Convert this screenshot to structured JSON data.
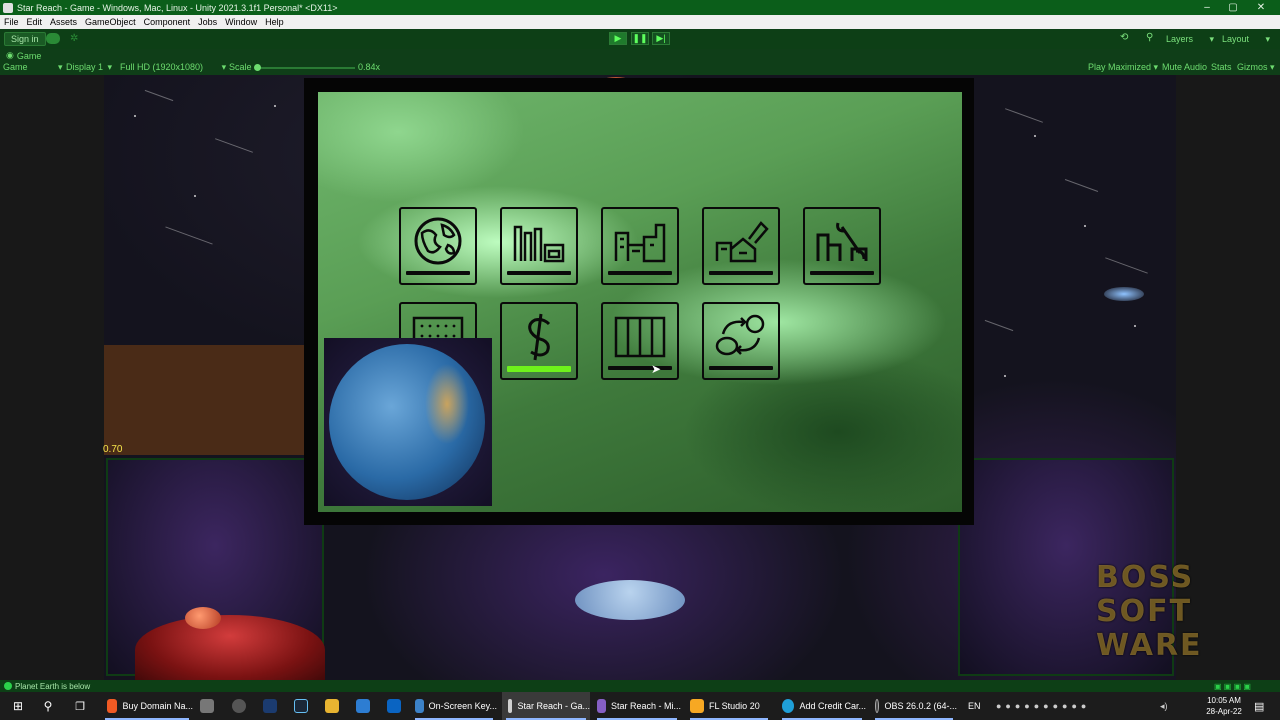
{
  "window": {
    "title": "Star Reach - Game - Windows, Mac, Linux - Unity 2021.3.1f1 Personal* <DX11>",
    "controls": [
      "–",
      "▢",
      "✕"
    ]
  },
  "menu": [
    "File",
    "Edit",
    "Assets",
    "GameObject",
    "Component",
    "Jobs",
    "Window",
    "Help"
  ],
  "toolbar": {
    "sign_in": "Sign in",
    "layers": "Layers",
    "layout": "Layout"
  },
  "game_view": {
    "tab": "Game",
    "mode": "Game",
    "display": "Display 1",
    "resolution": "Full HD (1920x1080)",
    "scale_label": "Scale",
    "scale_value": "0.84x",
    "play_maximized": "Play Maximized",
    "mute_audio": "Mute Audio",
    "stats": "Stats",
    "gizmos": "Gizmos"
  },
  "scene": {
    "value_readout": "0.70",
    "watermark": [
      "BOSS",
      "SOFT",
      "WARE"
    ]
  },
  "status": {
    "message": "Planet Earth is below"
  },
  "taskbar": {
    "apps": [
      {
        "label": "Buy Domain Na...",
        "icon": "brave-icon",
        "color": "#f05a24"
      },
      {
        "label": "",
        "icon": "app-icon",
        "color": "#777777"
      },
      {
        "label": "",
        "icon": "obs-circle-icon",
        "color": "#555555"
      },
      {
        "label": "",
        "icon": "photoshop-icon",
        "color": "#1b3b6f"
      },
      {
        "label": "",
        "icon": "steam-icon",
        "color": "#1b2838"
      },
      {
        "label": "",
        "icon": "folder-icon",
        "color": "#e8b431"
      },
      {
        "label": "",
        "icon": "monitor-icon",
        "color": "#2d7dd2"
      },
      {
        "label": "",
        "icon": "outlook-icon",
        "color": "#0a64c2"
      },
      {
        "label": "On-Screen Key...",
        "icon": "keyboard-icon",
        "color": "#3c82c8"
      },
      {
        "label": "Star Reach - Ga...",
        "icon": "unity-icon",
        "color": "#d0d0d0"
      },
      {
        "label": "Star Reach - Mi...",
        "icon": "visual-studio-icon",
        "color": "#865fc5"
      },
      {
        "label": "FL Studio 20",
        "icon": "fl-studio-icon",
        "color": "#f7a823"
      },
      {
        "label": "Add Credit Car...",
        "icon": "edge-icon",
        "color": "#1f9fd8"
      },
      {
        "label": "OBS 26.0.2 (64-...",
        "icon": "obs-icon",
        "color": "#444444"
      }
    ],
    "language": "EN",
    "time": "10:05 AM",
    "date": "28-Apr-22"
  }
}
